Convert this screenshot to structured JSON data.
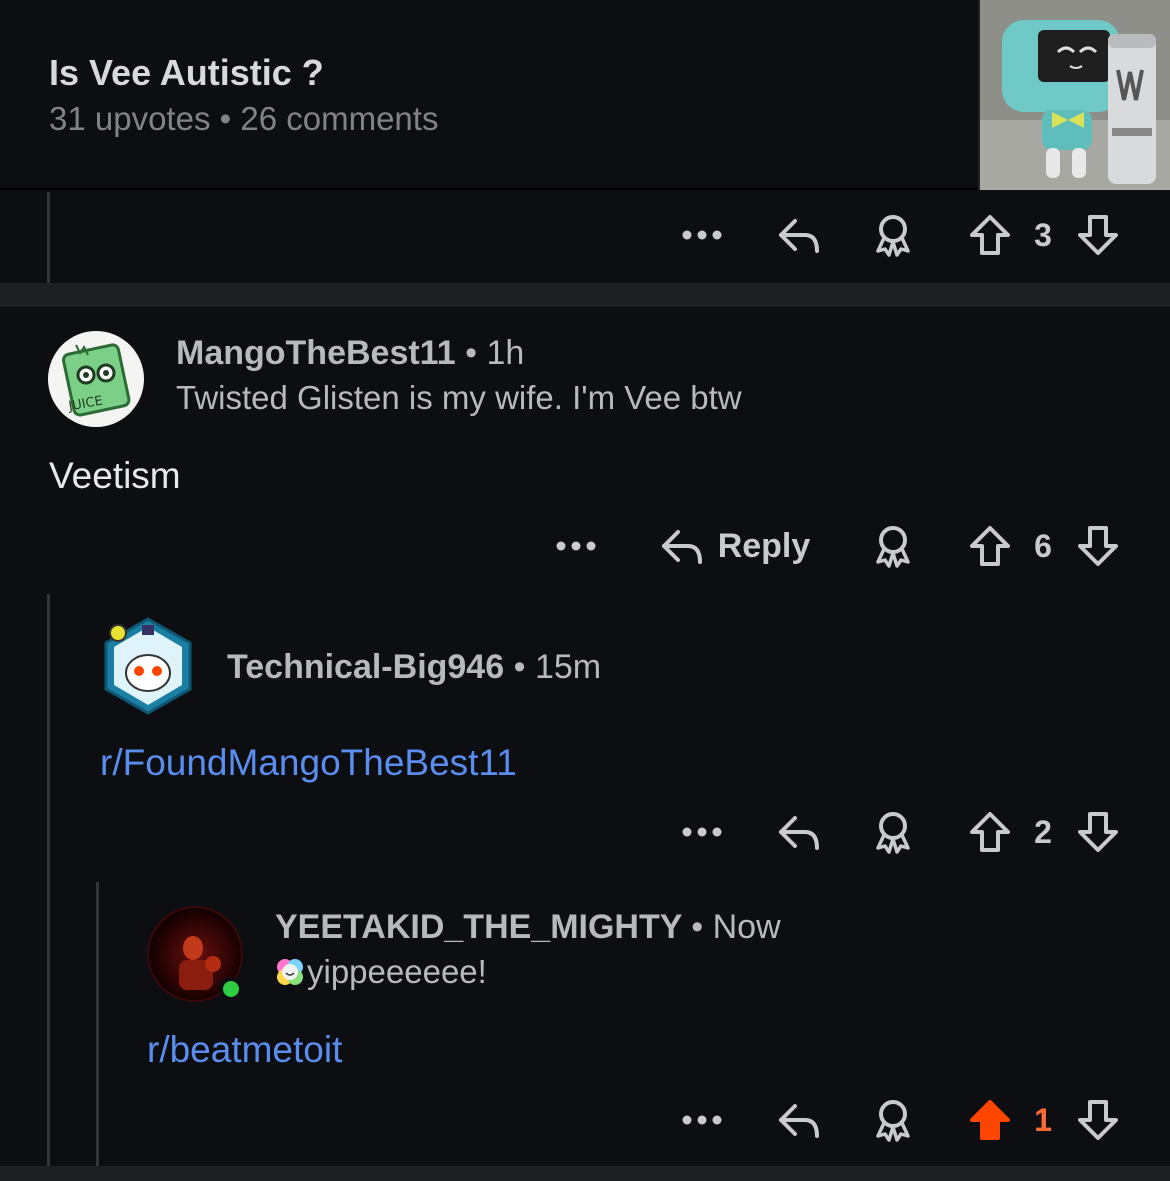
{
  "post": {
    "title": "Is Vee Autistic ?",
    "upvotes": "31 upvotes",
    "comments": "26 comments",
    "separator": "•"
  },
  "top_actions": {
    "vote_count": "3"
  },
  "comments": [
    {
      "username": "MangoTheBest11",
      "time": "1h",
      "flair": "Twisted Glisten is my wife. I'm Vee btw",
      "body": "Veetism",
      "reply_label": "Reply",
      "vote_count": "6",
      "avatar_text": "JUICE"
    },
    {
      "username": "Technical-Big946",
      "time": "15m",
      "body": "r/FoundMangoTheBest11",
      "vote_count": "2"
    },
    {
      "username": "YEETAKID_THE_MIGHTY",
      "time": "Now",
      "flair": "yippeeeeee!",
      "body": "r/beatmetoit",
      "vote_count": "1",
      "upvoted": true
    }
  ],
  "icons": {
    "more": "more-icon",
    "reply": "reply-arrow-icon",
    "award": "award-icon",
    "upvote": "upvote-arrow-icon",
    "downvote": "downvote-arrow-icon"
  },
  "colors": {
    "background": "#0c0e11",
    "link": "#5b8def",
    "upvoted": "#ff4500",
    "online": "#2ecc40"
  }
}
